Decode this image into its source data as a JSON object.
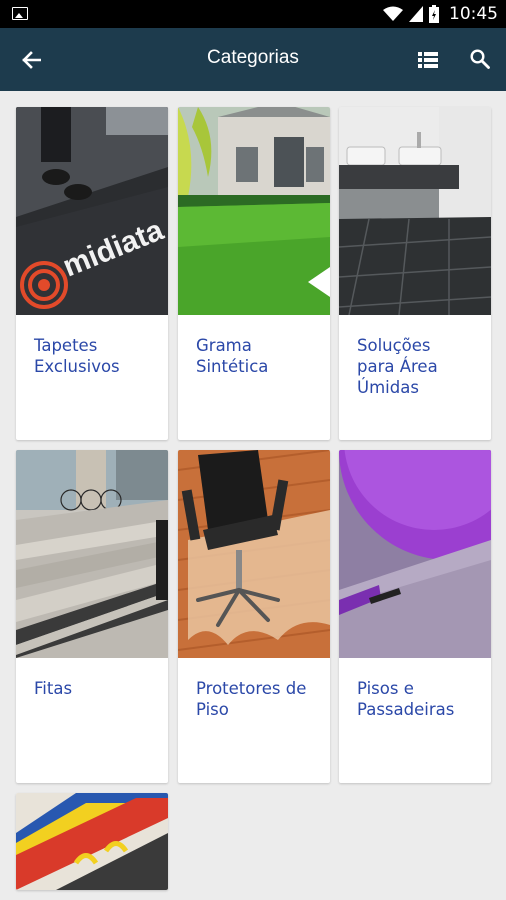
{
  "status_bar": {
    "time": "10:45"
  },
  "app_bar": {
    "title": "Categorias"
  },
  "categories": [
    {
      "label": "Tapetes Exclusivos",
      "image_text": "midiata"
    },
    {
      "label": "Grama Sintética"
    },
    {
      "label": "Soluções para Área Úmidas"
    },
    {
      "label": "Fitas"
    },
    {
      "label": "Protetores de Piso"
    },
    {
      "label": "Pisos e Passadeiras"
    },
    {
      "label": ""
    }
  ],
  "colors": {
    "app_bar": "#1d3b4d",
    "label": "#2b48a8",
    "background": "#ececec"
  }
}
